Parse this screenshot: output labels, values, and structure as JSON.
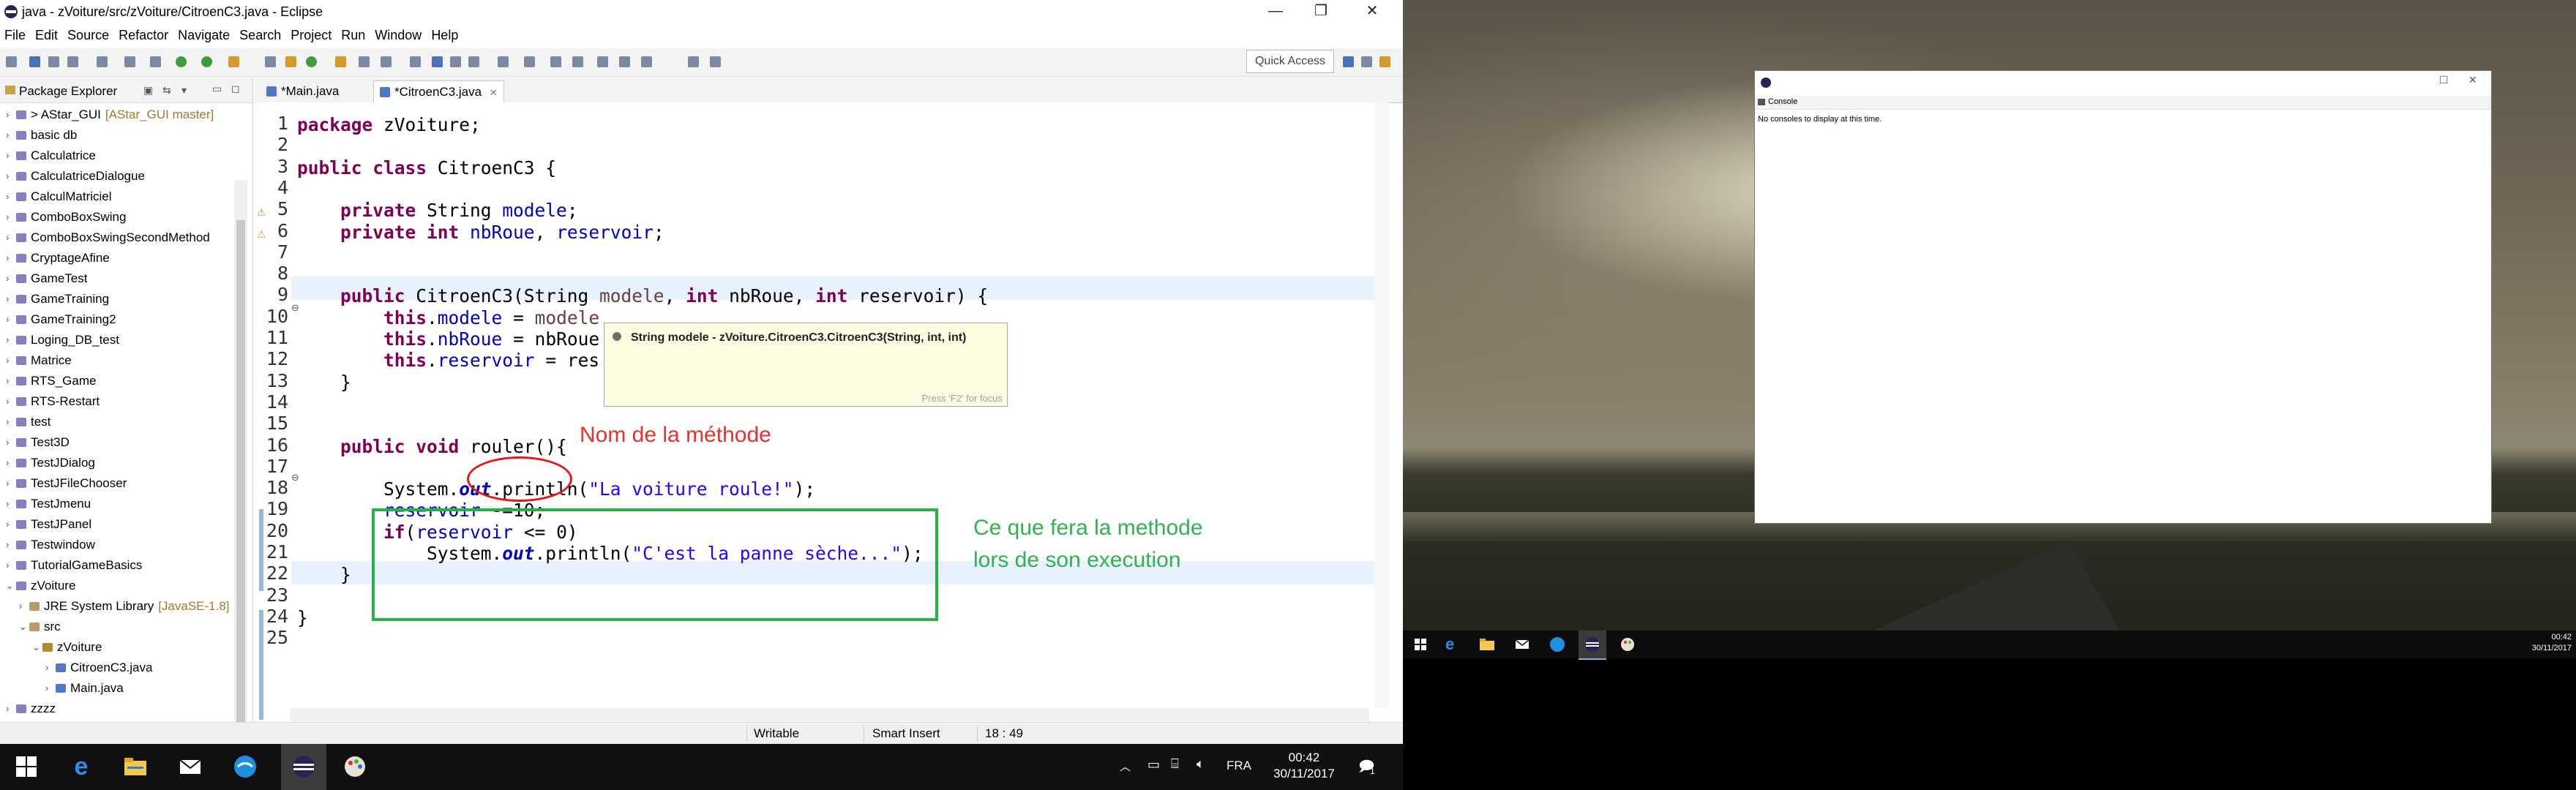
{
  "window": {
    "title": "java - zVoiture/src/zVoiture/CitroenC3.java - Eclipse",
    "minimize": "—",
    "maximize": "❐",
    "close": "✕"
  },
  "menu": [
    "File",
    "Edit",
    "Source",
    "Refactor",
    "Navigate",
    "Search",
    "Project",
    "Run",
    "Window",
    "Help"
  ],
  "toolbar": {
    "quick_access": "Quick Access"
  },
  "package_explorer": {
    "title": "Package Explorer",
    "items": [
      {
        "label": "> AStar_GUI",
        "decoration": "[AStar_GUI master]",
        "depth": 0,
        "chev": "›",
        "icon": "project-icon"
      },
      {
        "label": "basic db",
        "decoration": "",
        "depth": 0,
        "chev": "›",
        "icon": "project-icon"
      },
      {
        "label": "Calculatrice",
        "decoration": "",
        "depth": 0,
        "chev": "›",
        "icon": "project-icon"
      },
      {
        "label": "CalculatriceDialogue",
        "decoration": "",
        "depth": 0,
        "chev": "›",
        "icon": "project-icon"
      },
      {
        "label": "CalculMatriciel",
        "decoration": "",
        "depth": 0,
        "chev": "›",
        "icon": "project-icon"
      },
      {
        "label": "ComboBoxSwing",
        "decoration": "",
        "depth": 0,
        "chev": "›",
        "icon": "project-icon"
      },
      {
        "label": "ComboBoxSwingSecondMethod",
        "decoration": "",
        "depth": 0,
        "chev": "›",
        "icon": "project-icon"
      },
      {
        "label": "CryptageAfine",
        "decoration": "",
        "depth": 0,
        "chev": "›",
        "icon": "project-icon"
      },
      {
        "label": "GameTest",
        "decoration": "",
        "depth": 0,
        "chev": "›",
        "icon": "project-icon"
      },
      {
        "label": "GameTraining",
        "decoration": "",
        "depth": 0,
        "chev": "›",
        "icon": "project-icon"
      },
      {
        "label": "GameTraining2",
        "decoration": "",
        "depth": 0,
        "chev": "›",
        "icon": "project-icon"
      },
      {
        "label": "Loging_DB_test",
        "decoration": "",
        "depth": 0,
        "chev": "›",
        "icon": "project-icon"
      },
      {
        "label": "Matrice",
        "decoration": "",
        "depth": 0,
        "chev": "›",
        "icon": "project-icon"
      },
      {
        "label": "RTS_Game",
        "decoration": "",
        "depth": 0,
        "chev": "›",
        "icon": "project-icon"
      },
      {
        "label": "RTS-Restart",
        "decoration": "",
        "depth": 0,
        "chev": "›",
        "icon": "project-icon"
      },
      {
        "label": "test",
        "decoration": "",
        "depth": 0,
        "chev": "›",
        "icon": "project-icon"
      },
      {
        "label": "Test3D",
        "decoration": "",
        "depth": 0,
        "chev": "›",
        "icon": "project-icon"
      },
      {
        "label": "TestJDialog",
        "decoration": "",
        "depth": 0,
        "chev": "›",
        "icon": "project-icon"
      },
      {
        "label": "TestJFileChooser",
        "decoration": "",
        "depth": 0,
        "chev": "›",
        "icon": "project-icon"
      },
      {
        "label": "TestJmenu",
        "decoration": "",
        "depth": 0,
        "chev": "›",
        "icon": "project-icon"
      },
      {
        "label": "TestJPanel",
        "decoration": "",
        "depth": 0,
        "chev": "›",
        "icon": "project-icon"
      },
      {
        "label": "Testwindow",
        "decoration": "",
        "depth": 0,
        "chev": "›",
        "icon": "project-icon"
      },
      {
        "label": "TutorialGameBasics",
        "decoration": "",
        "depth": 0,
        "chev": "›",
        "icon": "project-icon"
      },
      {
        "label": "zVoiture",
        "decoration": "",
        "depth": 0,
        "chev": "⌄",
        "icon": "project-icon"
      },
      {
        "label": "JRE System Library",
        "decoration": "[JavaSE-1.8]",
        "depth": 1,
        "chev": "›",
        "icon": "library-icon"
      },
      {
        "label": "src",
        "decoration": "",
        "depth": 1,
        "chev": "⌄",
        "icon": "source-folder-icon"
      },
      {
        "label": "zVoiture",
        "decoration": "",
        "depth": 2,
        "chev": "⌄",
        "icon": "package-icon"
      },
      {
        "label": "CitroenC3.java",
        "decoration": "",
        "depth": 3,
        "chev": "›",
        "icon": "java-file-icon"
      },
      {
        "label": "Main.java",
        "decoration": "",
        "depth": 3,
        "chev": "›",
        "icon": "java-file-icon"
      },
      {
        "label": "zzzz",
        "decoration": "",
        "depth": 0,
        "chev": "›",
        "icon": "project-icon"
      }
    ]
  },
  "editor": {
    "tabs": [
      {
        "label": "*Main.java",
        "active": false
      },
      {
        "label": "*CitroenC3.java",
        "active": true,
        "close": "✕"
      }
    ],
    "line_numbers": [
      "1",
      "2",
      "3",
      "4",
      "5",
      "6",
      "7",
      "8",
      "9",
      "10",
      "11",
      "12",
      "13",
      "14",
      "15",
      "16",
      "17",
      "18",
      "19",
      "20",
      "21",
      "22",
      "23",
      "24",
      "25"
    ],
    "lines": [
      [
        {
          "t": "package",
          "c": "kw"
        },
        {
          "t": " zVoiture;"
        }
      ],
      [],
      [
        {
          "t": "public class",
          "c": "kw"
        },
        {
          "t": " CitroenC3 {"
        }
      ],
      [],
      [
        {
          "t": "    "
        },
        {
          "t": "private",
          "c": "kw"
        },
        {
          "t": " String "
        },
        {
          "t": "modele",
          "c": "fld"
        },
        {
          "t": ";"
        }
      ],
      [
        {
          "t": "    "
        },
        {
          "t": "private int",
          "c": "kw"
        },
        {
          "t": " "
        },
        {
          "t": "nbRoue",
          "c": "fld"
        },
        {
          "t": ", "
        },
        {
          "t": "reservoir",
          "c": "fld"
        },
        {
          "t": ";"
        }
      ],
      [],
      [],
      [
        {
          "t": "    "
        },
        {
          "t": "public",
          "c": "kw"
        },
        {
          "t": " CitroenC3(String "
        },
        {
          "t": "modele",
          "c": "par"
        },
        {
          "t": ", "
        },
        {
          "t": "int",
          "c": "kw"
        },
        {
          "t": " nbRoue, "
        },
        {
          "t": "int",
          "c": "kw"
        },
        {
          "t": " reservoir) {"
        }
      ],
      [
        {
          "t": "        "
        },
        {
          "t": "this",
          "c": "kw"
        },
        {
          "t": "."
        },
        {
          "t": "modele",
          "c": "fld"
        },
        {
          "t": " = "
        },
        {
          "t": "modele",
          "c": "par"
        }
      ],
      [
        {
          "t": "        "
        },
        {
          "t": "this",
          "c": "kw"
        },
        {
          "t": "."
        },
        {
          "t": "nbRoue",
          "c": "fld"
        },
        {
          "t": " = nbRoue"
        }
      ],
      [
        {
          "t": "        "
        },
        {
          "t": "this",
          "c": "kw"
        },
        {
          "t": "."
        },
        {
          "t": "reservoir",
          "c": "fld"
        },
        {
          "t": " = res"
        }
      ],
      [
        {
          "t": "    }"
        }
      ],
      [],
      [],
      [
        {
          "t": "    "
        },
        {
          "t": "public void",
          "c": "kw"
        },
        {
          "t": " rouler(){"
        }
      ],
      [],
      [
        {
          "t": "        System."
        },
        {
          "t": "out",
          "c": "st"
        },
        {
          "t": ".println("
        },
        {
          "t": "\"La voiture roule!\"",
          "c": "str"
        },
        {
          "t": ");"
        }
      ],
      [
        {
          "t": "        "
        },
        {
          "t": "reservoir",
          "c": "fld"
        },
        {
          "t": " -=10;"
        }
      ],
      [
        {
          "t": "        "
        },
        {
          "t": "if",
          "c": "kw"
        },
        {
          "t": "("
        },
        {
          "t": "reservoir",
          "c": "fld"
        },
        {
          "t": " <= 0)"
        }
      ],
      [
        {
          "t": "            System."
        },
        {
          "t": "out",
          "c": "st"
        },
        {
          "t": ".println("
        },
        {
          "t": "\"C'est la panne sèche...\"",
          "c": "str"
        },
        {
          "t": ");"
        }
      ],
      [
        {
          "t": "    }"
        }
      ],
      [],
      [
        {
          "t": "}"
        }
      ],
      []
    ],
    "tooltip": {
      "text": "String modele - zVoiture.CitroenC3.CitroenC3(String, int, int)",
      "footer": "Press 'F2' for focus"
    }
  },
  "annotations": {
    "method_name": "Nom de la méthode",
    "method_body_line1": "Ce que fera la methode",
    "method_body_line2": "lors de son execution",
    "oval_color": "#e01919",
    "box_color": "#27b045"
  },
  "status": {
    "writable": "Writable",
    "insert_mode": "Smart Insert",
    "position": "18 : 49"
  },
  "taskbar": {
    "language": "FRA",
    "time": "00:42",
    "date": "30/11/2017",
    "notification_count": "1"
  },
  "console": {
    "tab": "Console",
    "message": "No consoles to display at this time."
  },
  "taskbar2": {
    "time": "00:42",
    "date": "30/11/2017"
  }
}
